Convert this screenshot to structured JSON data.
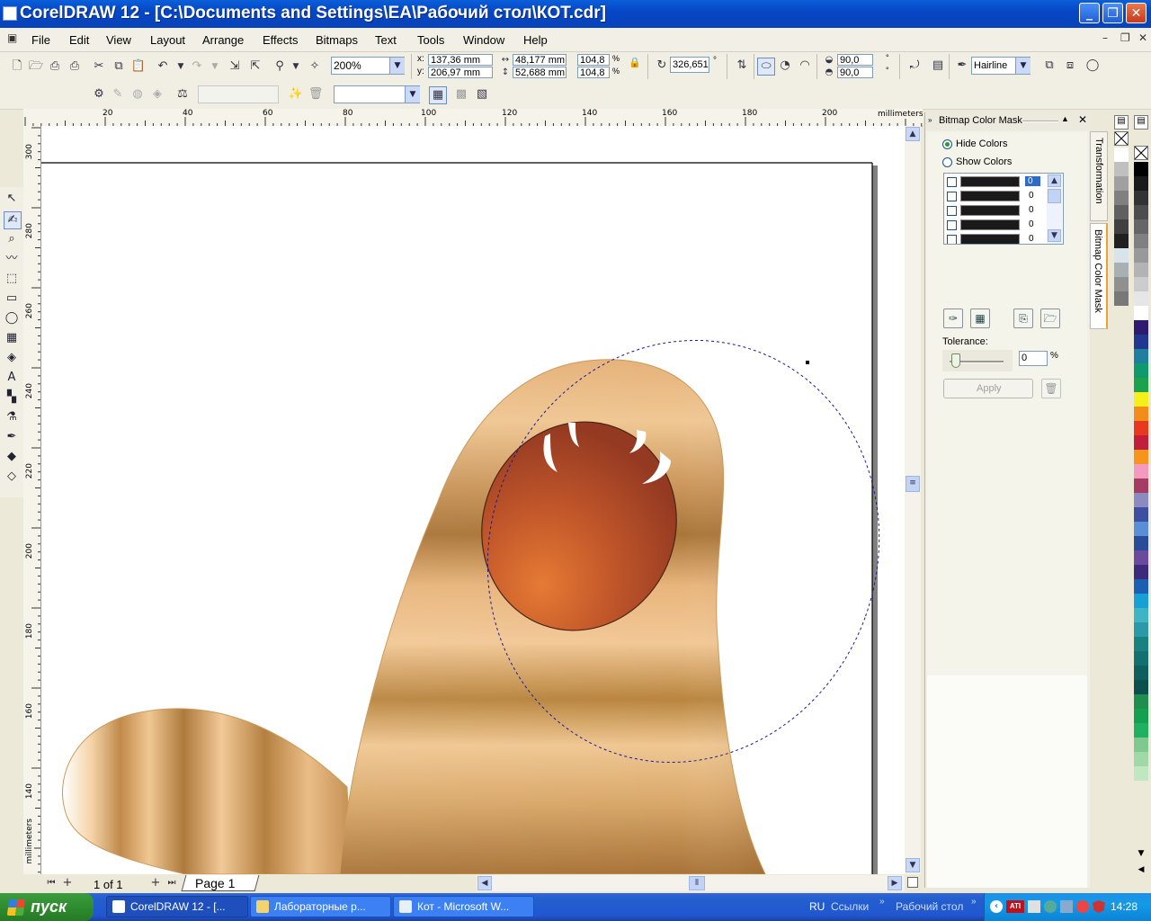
{
  "window": {
    "title": "CorelDRAW 12 - [C:\\Documents and Settings\\EA\\Рабочий стол\\КОТ.cdr]"
  },
  "menu": [
    "File",
    "Edit",
    "View",
    "Layout",
    "Arrange",
    "Effects",
    "Bitmaps",
    "Text",
    "Tools",
    "Window",
    "Help"
  ],
  "toolbar": {
    "zoom": "200%",
    "x": "137,36 mm",
    "y": "206,97 mm",
    "x_label": "x:",
    "y_label": "y:",
    "width": "48,177 mm",
    "height": "52,688 mm",
    "scale_x": "104,8",
    "scale_y": "104,8",
    "pct": "%",
    "rotation": "326,651",
    "degree": "°",
    "angle_start": "90,0",
    "angle_end": "90,0",
    "outline": "Hairline"
  },
  "ruler": {
    "unit": "millimeters",
    "top_ticks": [
      "20",
      "40",
      "60",
      "80",
      "100",
      "120",
      "140",
      "160",
      "180",
      "200"
    ],
    "left_ticks": [
      "300",
      "280",
      "260",
      "240",
      "220",
      "200",
      "180",
      "160",
      "140"
    ]
  },
  "pages": {
    "counter": "1 of 1",
    "tab": "Page 1"
  },
  "docker": {
    "title": "Bitmap Color Mask",
    "hide_colors": "Hide Colors",
    "show_colors": "Show Colors",
    "color_rows": [
      "0",
      "0",
      "0",
      "0",
      "0"
    ],
    "tolerance_label": "Tolerance:",
    "tolerance_value": "0",
    "tolerance_unit": "%",
    "apply": "Apply",
    "tabs": [
      "Transformation",
      "Bitmap Color Mask"
    ]
  },
  "palette": {
    "left": [
      "#ffffff",
      "#c0c0c0",
      "#a0a0a0",
      "#808080",
      "#606060",
      "#404040",
      "#202020",
      "#d8e4ea",
      "#a8b0b4",
      "#909090",
      "#787878"
    ],
    "right": [
      "#000000",
      "#1a1a1a",
      "#333333",
      "#4d4d4d",
      "#666666",
      "#808080",
      "#999999",
      "#b3b3b3",
      "#cccccc",
      "#e6e6e6",
      "#ffffff",
      "#2e1a6e",
      "#20388f",
      "#1f7f9f",
      "#0e9a6c",
      "#1ba24c",
      "#f6ef1c",
      "#f28c1a",
      "#e8381f",
      "#c21d3a",
      "#f7941d",
      "#f39ac0",
      "#a43c63",
      "#8c8bbf",
      "#3c4fa0",
      "#5a8fd8",
      "#2a4a9a",
      "#6a4a9e",
      "#3c2a7a",
      "#1a5fb4",
      "#17a0d6",
      "#3fb4c4",
      "#2a9aa8",
      "#1a8080",
      "#137070",
      "#0f5f5f",
      "#0b4f4f",
      "#1f8f4f",
      "#14a050",
      "#1fb060",
      "#7fc890",
      "#a0d8a8",
      "#c0e8c0"
    ]
  },
  "taskbar": {
    "start": "пуск",
    "tasks": [
      "CorelDRAW 12 - [...",
      "Лабораторные р...",
      "Кот - Microsoft W..."
    ],
    "lang": "RU",
    "links": "Ссылки",
    "desktop": "Рабочий стол",
    "clock": "14:28"
  }
}
